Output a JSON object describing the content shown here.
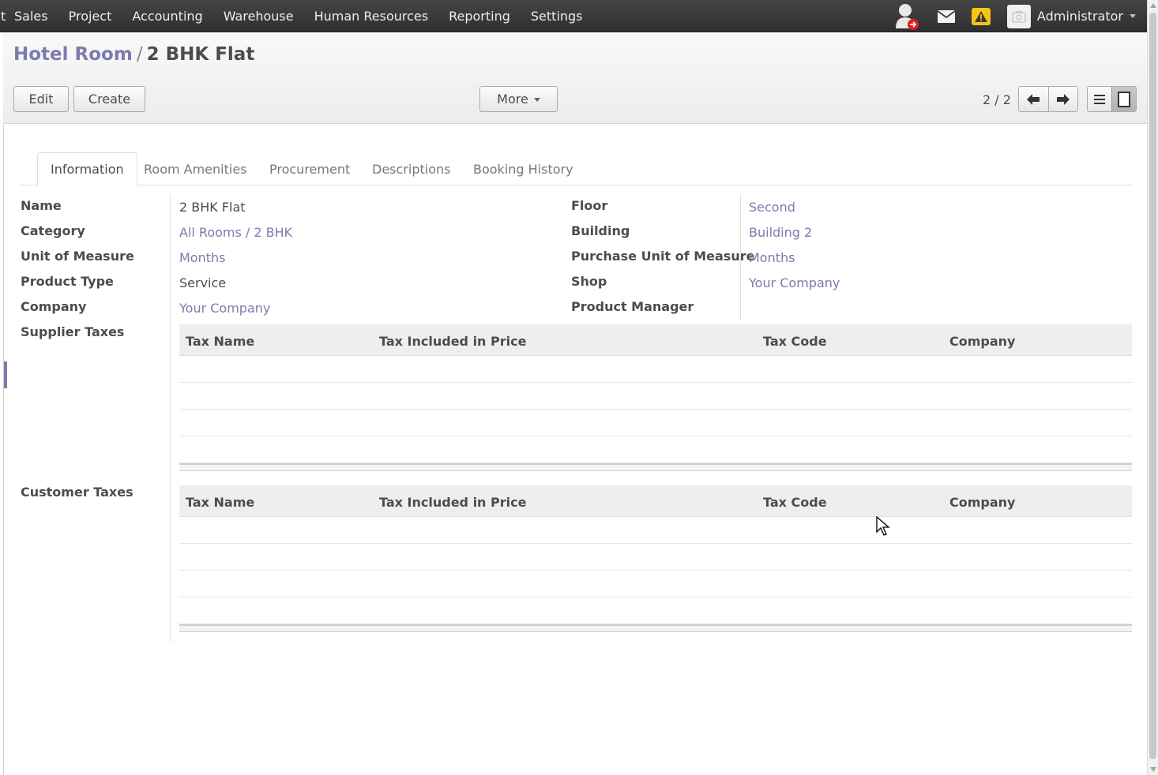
{
  "topbar": {
    "cut_item": "t",
    "menu": [
      "Sales",
      "Project",
      "Accounting",
      "Warehouse",
      "Human Resources",
      "Reporting",
      "Settings"
    ],
    "user_name": "Administrator",
    "icons": [
      "user-status-icon",
      "mail-icon",
      "warning-icon",
      "user-avatar-icon"
    ]
  },
  "breadcrumb": {
    "parent": "Hotel Room",
    "separator": "/",
    "current": "2 BHK Flat"
  },
  "toolbar": {
    "edit_label": "Edit",
    "create_label": "Create",
    "more_label": "More"
  },
  "pager": {
    "text": "2 / 2"
  },
  "tabs": [
    "Information",
    "Room Amenities",
    "Procurement",
    "Descriptions",
    "Booking History"
  ],
  "active_tab": "Information",
  "form": {
    "left": {
      "name": {
        "label": "Name",
        "value": "2 BHK Flat"
      },
      "category": {
        "label": "Category",
        "value": "All Rooms / 2 BHK"
      },
      "uom": {
        "label": "Unit of Measure",
        "value": "Months"
      },
      "product_type": {
        "label": "Product Type",
        "value": "Service"
      },
      "company": {
        "label": "Company",
        "value": "Your Company"
      }
    },
    "right": {
      "floor": {
        "label": "Floor",
        "value": "Second"
      },
      "building": {
        "label": "Building",
        "value": "Building 2"
      },
      "purchase_uom": {
        "label": "Purchase Unit of Measure",
        "value": "Months"
      },
      "shop": {
        "label": "Shop",
        "value": "Your Company"
      },
      "product_manager": {
        "label": "Product Manager",
        "value": ""
      }
    },
    "supplier_taxes": {
      "label": "Supplier Taxes",
      "columns": [
        "Tax Name",
        "Tax Included in Price",
        "Tax Code",
        "Company"
      ],
      "rows": []
    },
    "customer_taxes": {
      "label": "Customer Taxes",
      "columns": [
        "Tax Name",
        "Tax Included in Price",
        "Tax Code",
        "Company"
      ],
      "rows": []
    }
  },
  "colors": {
    "link": "#7c7bad",
    "topbar": "#3b3b3b",
    "text": "#4c4c4c"
  }
}
